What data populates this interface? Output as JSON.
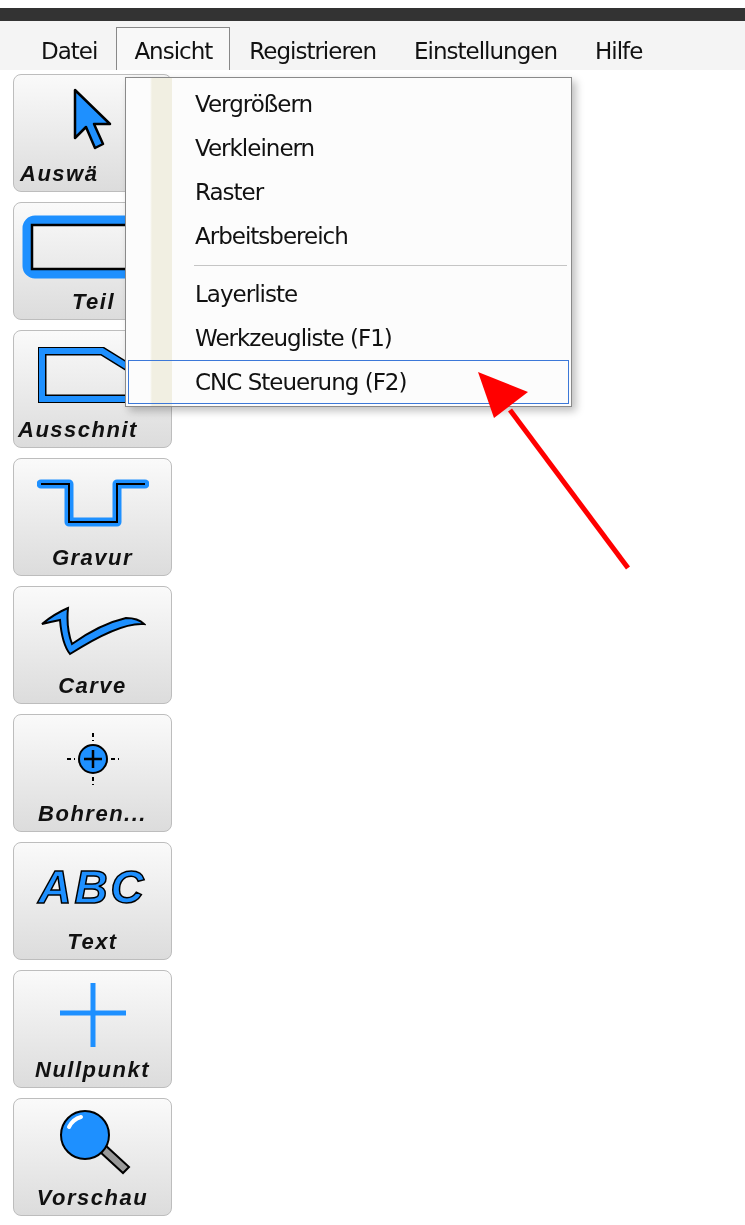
{
  "menu_bar": [
    {
      "label": "Datei",
      "selected": false
    },
    {
      "label": "Ansicht",
      "selected": true
    },
    {
      "label": "Registrieren",
      "selected": false
    },
    {
      "label": "Einstellungen",
      "selected": false
    },
    {
      "label": "Hilfe",
      "selected": false
    }
  ],
  "dropdown": {
    "groups": [
      [
        {
          "label": "Vergrößern",
          "selected": false
        },
        {
          "label": "Verkleinern",
          "selected": false
        },
        {
          "label": "Raster",
          "selected": false
        },
        {
          "label": "Arbeitsbereich",
          "selected": false
        }
      ],
      [
        {
          "label": "Layerliste",
          "selected": false
        },
        {
          "label": "Werkzeugliste (F1)",
          "selected": false
        },
        {
          "label": "CNC Steuerung (F2)",
          "selected": true
        }
      ]
    ]
  },
  "toolbar": [
    {
      "kind": "select",
      "label": "Auswä"
    },
    {
      "kind": "part",
      "label": "Teil"
    },
    {
      "kind": "cutout",
      "label": "Ausschnit"
    },
    {
      "kind": "engrave",
      "label": "Gravur"
    },
    {
      "kind": "carve",
      "label": "Carve"
    },
    {
      "kind": "drill",
      "label": "Bohren..."
    },
    {
      "kind": "text",
      "label": "Text",
      "icon_text": "ABC"
    },
    {
      "kind": "origin",
      "label": "Nullpunkt"
    },
    {
      "kind": "preview",
      "label": "Vorschau"
    }
  ],
  "annotation": {
    "kind": "arrow"
  }
}
